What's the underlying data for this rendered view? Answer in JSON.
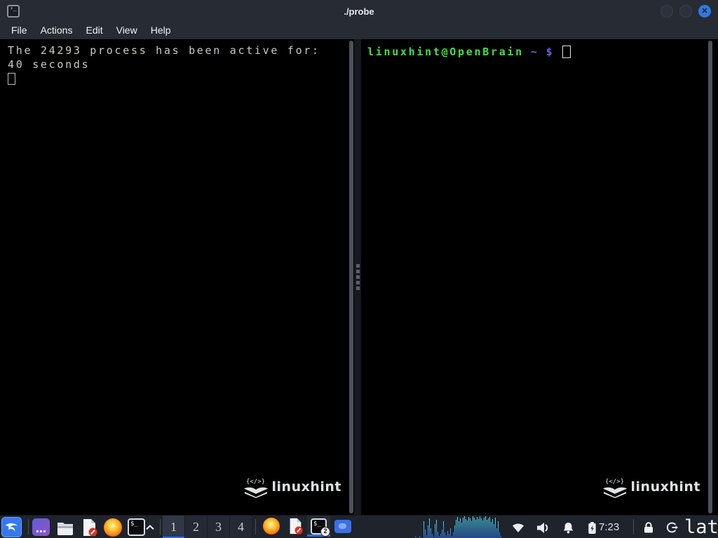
{
  "window": {
    "title": "./probe",
    "menu": [
      "File",
      "Actions",
      "Edit",
      "View",
      "Help"
    ],
    "close_glyph": "✕"
  },
  "terminal": {
    "left": {
      "line1": "The 24293 process has been active for:",
      "line2": "40 seconds"
    },
    "right": {
      "user": "linuxhint@OpenBrain",
      "path": "~",
      "symbol": "$"
    },
    "watermark": {
      "code": "{</>}",
      "label": "linuxhint"
    }
  },
  "taskbar": {
    "terminal_glyph": "$_",
    "workspaces": [
      "1",
      "2",
      "3",
      "4"
    ],
    "active_workspace": "1",
    "terminal_badge": "2",
    "clock": "7:23",
    "status_text": "lat",
    "visualizer_bars": [
      0,
      0,
      2,
      1,
      0,
      3,
      1,
      0,
      24,
      12,
      4,
      18,
      28,
      14,
      6,
      2,
      20,
      26,
      9,
      3,
      6,
      12,
      24,
      8,
      4,
      10,
      6,
      14,
      3,
      8,
      18,
      26,
      30,
      24,
      28,
      22,
      29,
      31,
      27,
      25,
      30,
      28,
      24,
      31,
      29,
      26,
      30,
      27,
      31,
      28,
      25,
      29,
      31,
      26,
      28,
      30,
      23,
      27,
      20,
      29,
      14,
      24,
      8,
      3
    ]
  },
  "colors": {
    "accent": "#2f6fe4",
    "prompt_green": "#3fe23f",
    "prompt_blue": "#6663e8",
    "visualizer_top": "#58e8f4",
    "visualizer_bottom": "#2b6be0",
    "titlebar_bg": "#262b34",
    "taskbar_bg": "#1f232c"
  }
}
